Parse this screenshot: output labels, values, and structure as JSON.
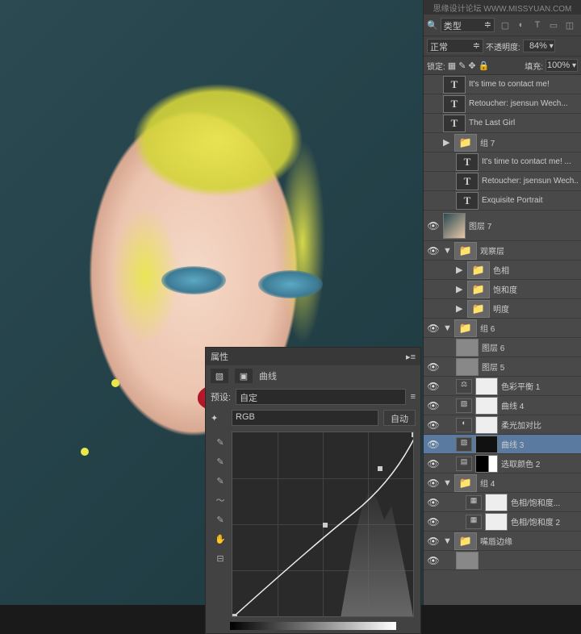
{
  "watermark": "思缘设计论坛  WWW.MISSYUAN.COM",
  "properties": {
    "title": "属性",
    "subtitle": "曲线",
    "preset_label": "预设:",
    "preset_value": "自定",
    "channel": "RGB",
    "auto": "自动"
  },
  "options": {
    "kind_label": "类型",
    "blend_mode": "正常",
    "opacity_label": "不透明度:",
    "opacity_value": "84%",
    "lock_label": "锁定:",
    "fill_label": "填充:",
    "fill_value": "100%"
  },
  "layers": [
    {
      "vis": false,
      "type": "text",
      "name": "It's time to contact me!"
    },
    {
      "vis": false,
      "type": "text",
      "name": "Retoucher: jsensun Wech..."
    },
    {
      "vis": false,
      "type": "text",
      "name": "The Last Girl"
    },
    {
      "vis": false,
      "type": "group",
      "name": "组 7",
      "collapsed": true
    },
    {
      "vis": false,
      "type": "text",
      "name": "It's time to contact me! ...",
      "indent": 1
    },
    {
      "vis": false,
      "type": "text",
      "name": "Retoucher: jsensun Wech...",
      "indent": 1
    },
    {
      "vis": false,
      "type": "text",
      "name": "Exquisite Portrait",
      "indent": 1
    },
    {
      "vis": true,
      "type": "image",
      "name": "图层 7"
    },
    {
      "vis": true,
      "type": "group",
      "name": "观察层",
      "open": true
    },
    {
      "vis": false,
      "type": "group",
      "name": "色相",
      "indent": 1,
      "collapsed": true
    },
    {
      "vis": false,
      "type": "group",
      "name": "饱和度",
      "indent": 1,
      "collapsed": true
    },
    {
      "vis": false,
      "type": "group",
      "name": "明度",
      "indent": 1,
      "collapsed": true
    },
    {
      "vis": true,
      "type": "group",
      "name": "组 6",
      "open": true
    },
    {
      "vis": false,
      "type": "layer",
      "name": "图层 6",
      "indent": 1,
      "thumb": "g"
    },
    {
      "vis": true,
      "type": "layer",
      "name": "图层 5",
      "indent": 1,
      "thumb": "g"
    },
    {
      "vis": true,
      "type": "adj",
      "name": "色彩平衡 1",
      "indent": 1,
      "mask": "w",
      "icon": "⚖"
    },
    {
      "vis": true,
      "type": "adj",
      "name": "曲线 4",
      "indent": 1,
      "mask": "w",
      "icon": "▧"
    },
    {
      "vis": true,
      "type": "adj",
      "name": "柔光加对比",
      "indent": 1,
      "mask": "w",
      "icon": "◐"
    },
    {
      "vis": true,
      "type": "adj",
      "name": "曲线 3",
      "indent": 1,
      "mask": "b",
      "icon": "▧",
      "selected": true
    },
    {
      "vis": true,
      "type": "adj",
      "name": "选取颜色 2",
      "indent": 1,
      "mask": "b2",
      "icon": "▤"
    },
    {
      "vis": true,
      "type": "group",
      "name": "组 4",
      "open": true
    },
    {
      "vis": true,
      "type": "adj",
      "name": "色相/饱和度...",
      "indent": 2,
      "mask": "w",
      "icon": "▦"
    },
    {
      "vis": true,
      "type": "adj",
      "name": "色相/饱和度 2",
      "indent": 2,
      "mask": "w",
      "icon": "▦"
    },
    {
      "vis": true,
      "type": "group",
      "name": "嘴唇边缘",
      "open": true
    },
    {
      "vis": true,
      "type": "layer",
      "name": "",
      "indent": 1,
      "thumb": "g"
    }
  ]
}
